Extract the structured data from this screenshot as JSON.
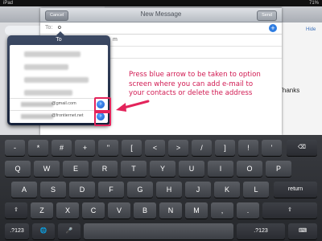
{
  "status_bar": {
    "left": "iPad",
    "time": "",
    "right": "71%"
  },
  "background": {
    "right_link": "Hide",
    "body_text": "Thanks"
  },
  "compose": {
    "title": "New Message",
    "cancel_label": "Cancel",
    "send_label": "Send",
    "to_label": "To:",
    "to_value": "o",
    "line_fragment": "m"
  },
  "popover": {
    "title": "To",
    "contacts": [
      {
        "email": "@gmail.com"
      },
      {
        "email": "@frontiernet.net"
      }
    ]
  },
  "annotation": {
    "line1": "Press blue arrow to be taken to option",
    "line2": "screen where you can add e-mail to",
    "line3": "your contacts or delete the address"
  },
  "colors": {
    "annotation": "#d11a52",
    "accent": "#2f7de1"
  },
  "icons": {
    "disclosure": "chevron-right-icon",
    "add": "plus-icon",
    "mic": "microphone-icon"
  },
  "keyboard": {
    "row1": [
      "-",
      "*",
      "#",
      "+",
      "\"",
      "[",
      "<",
      ">",
      "/",
      "]",
      "!",
      "'"
    ],
    "row2": [
      "Q",
      "W",
      "E",
      "R",
      "T",
      "Y",
      "U",
      "I",
      "O",
      "P"
    ],
    "row3": [
      "A",
      "S",
      "D",
      "F",
      "G",
      "H",
      "J",
      "K",
      "L"
    ],
    "return_label": "return",
    "row4": [
      "Z",
      "X",
      "C",
      "V",
      "B",
      "N",
      "M",
      ",",
      "."
    ],
    "numbers_label": ".?123",
    "numbers_label_right": ".?123"
  }
}
